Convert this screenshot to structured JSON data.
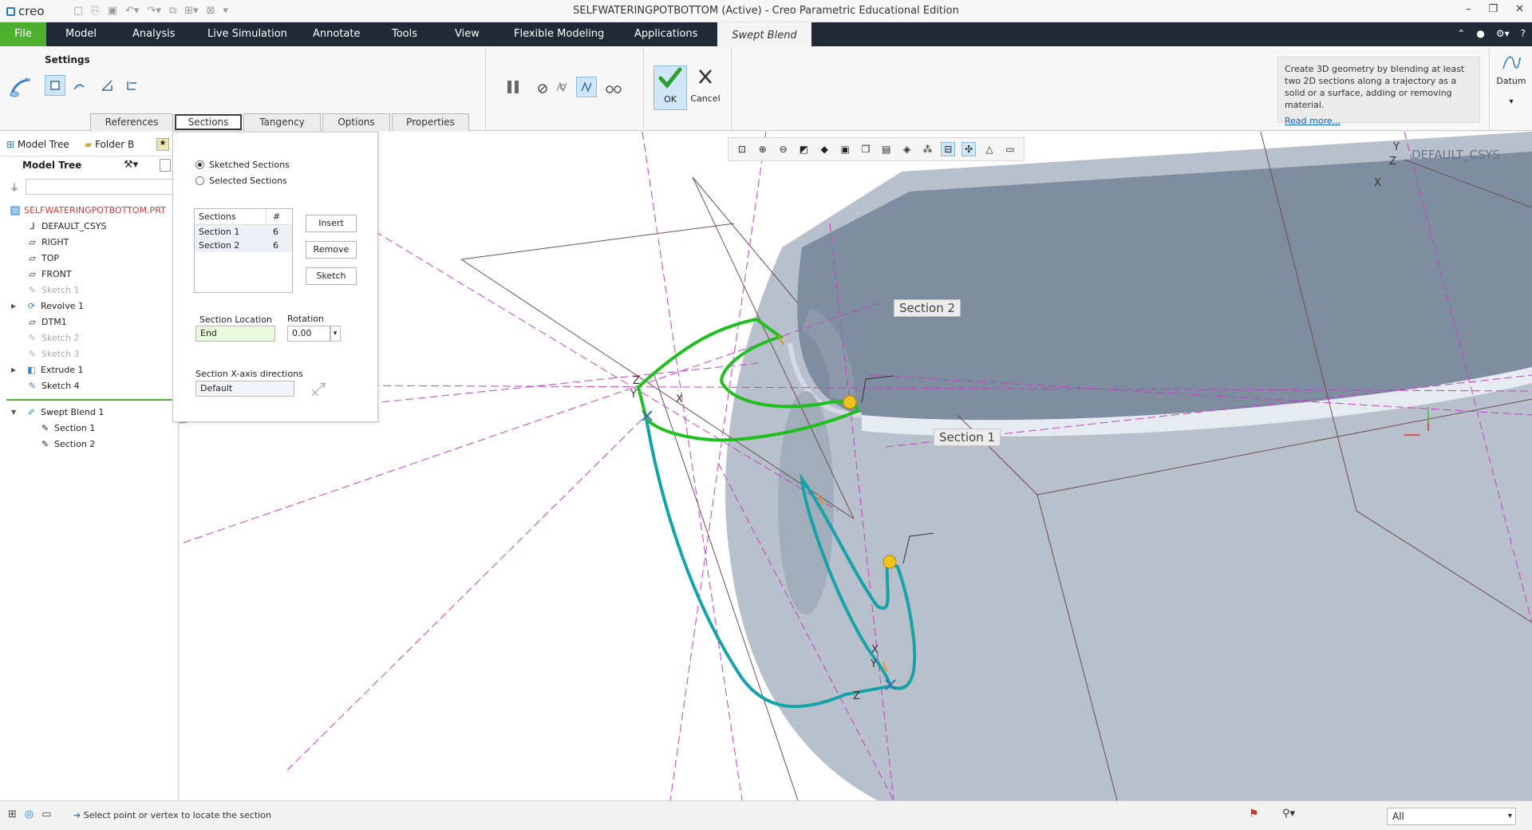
{
  "app": {
    "logo": "creo",
    "window_title": "SELFWATERINGPOTBOTTOM (Active) - Creo Parametric Educational Edition"
  },
  "ribbon_tabs": [
    "File",
    "Model",
    "Analysis",
    "Live Simulation",
    "Annotate",
    "Tools",
    "View",
    "Flexible Modeling",
    "Applications",
    "Swept Blend"
  ],
  "ribbon": {
    "settings_label": "Settings",
    "ok_label": "OK",
    "cancel_label": "Cancel",
    "datum_label": "Datum",
    "tip_text": "Create 3D geometry by blending at least two 2D sections along a trajectory as a solid or a surface, adding or removing material.",
    "tip_link": "Read more...",
    "subtabs": [
      "References",
      "Sections",
      "Tangency",
      "Options",
      "Properties"
    ]
  },
  "left_panel": {
    "tabs": [
      "Model Tree",
      "Folder B"
    ],
    "header": "Model Tree",
    "items": [
      {
        "label": "SELFWATERINGPOTBOTTOM.PRT",
        "icon": "part-icon"
      },
      {
        "label": "DEFAULT_CSYS",
        "icon": "csys-icon"
      },
      {
        "label": "RIGHT",
        "icon": "datum-plane-icon"
      },
      {
        "label": "TOP",
        "icon": "datum-plane-icon"
      },
      {
        "label": "FRONT",
        "icon": "datum-plane-icon"
      },
      {
        "label": "Sketch 1",
        "icon": "sketch-icon"
      },
      {
        "label": "Revolve 1",
        "icon": "revolve-icon"
      },
      {
        "label": "DTM1",
        "icon": "datum-plane-icon"
      },
      {
        "label": "Sketch 2",
        "icon": "sketch-icon"
      },
      {
        "label": "Sketch 3",
        "icon": "sketch-icon"
      },
      {
        "label": "Extrude 1",
        "icon": "extrude-icon"
      },
      {
        "label": "Sketch 4",
        "icon": "sketch-icon"
      },
      {
        "label": "Swept Blend 1",
        "icon": "swept-blend-icon"
      },
      {
        "label": "Section 1",
        "icon": "section-icon"
      },
      {
        "label": "Section 2",
        "icon": "section-icon"
      }
    ]
  },
  "sections_panel": {
    "radio_sketched": "Sketched Sections",
    "radio_selected": "Selected Sections",
    "list_header_name": "Sections",
    "list_header_count": "#",
    "rows": [
      {
        "name": "Section 1",
        "count": "6"
      },
      {
        "name": "Section 2",
        "count": "6"
      }
    ],
    "insert": "Insert",
    "remove": "Remove",
    "sketch": "Sketch",
    "location_label": "Section Location",
    "location_value": "End",
    "rotation_label": "Rotation",
    "rotation_value": "0.00",
    "xaxis_label": "Section X-axis directions",
    "xaxis_value": "Default"
  },
  "viewport": {
    "callout_section1": "Section 1",
    "callout_section2": "Section 2",
    "csys_label": "DEFAULT_CSYS",
    "axis_x": "X",
    "axis_y": "Y",
    "axis_z": "Z"
  },
  "status": {
    "message": "Select point or vertex to locate the section",
    "filter_value": "All"
  },
  "colors": {
    "file_tab": "#4caf2e",
    "ribbon_dark": "#1f2a36",
    "section2_curve": "#1fbf1f",
    "section1_curve": "#14a3a8",
    "datum_lines": "#c341c3",
    "ok_icon": "#2e9e2e"
  }
}
